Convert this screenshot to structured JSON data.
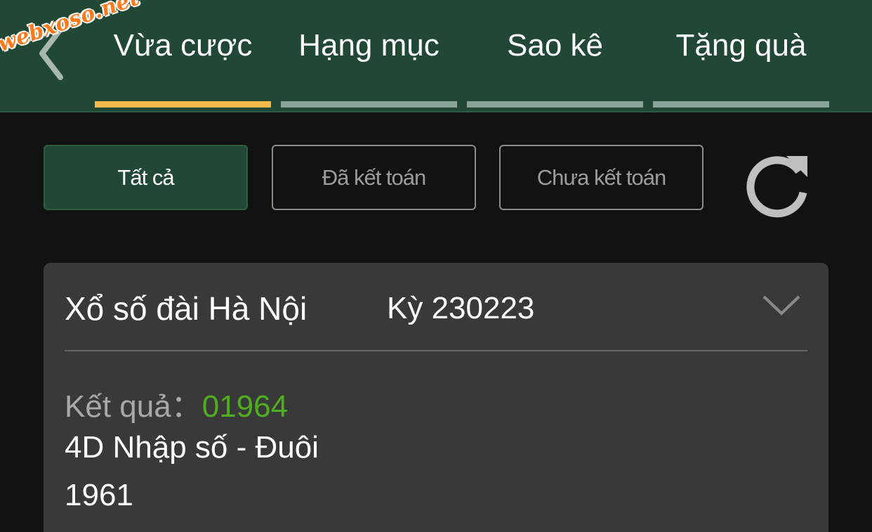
{
  "watermark": "webxoso.net",
  "header": {
    "back_icon": "chevron-left-icon",
    "tabs": [
      {
        "label": "Vừa cược",
        "active": true
      },
      {
        "label": "Hạng mục",
        "active": false
      },
      {
        "label": "Sao kê",
        "active": false
      },
      {
        "label": "Tặng quà",
        "active": false
      }
    ]
  },
  "filters": [
    {
      "label": "Tất cả",
      "active": true
    },
    {
      "label": "Đã kết toán",
      "active": false
    },
    {
      "label": "Chưa kết toán",
      "active": false
    }
  ],
  "refresh_icon": "refresh-icon",
  "card": {
    "title": "Xổ số đài Hà Nội",
    "period": "Kỳ 230223",
    "expand_icon": "chevron-down-icon",
    "result_label": "Kết quả：",
    "result_value": "01964",
    "bet_type": "4D Nhập số - Đuôi",
    "bet_number": "1961"
  },
  "colors": {
    "header_bg": "#214834",
    "active_tab_indicator": "#f2b849",
    "inactive_tab_indicator": "#8aa597",
    "result_green": "#4fae1e",
    "card_bg": "#393939",
    "page_bg": "#121212"
  }
}
